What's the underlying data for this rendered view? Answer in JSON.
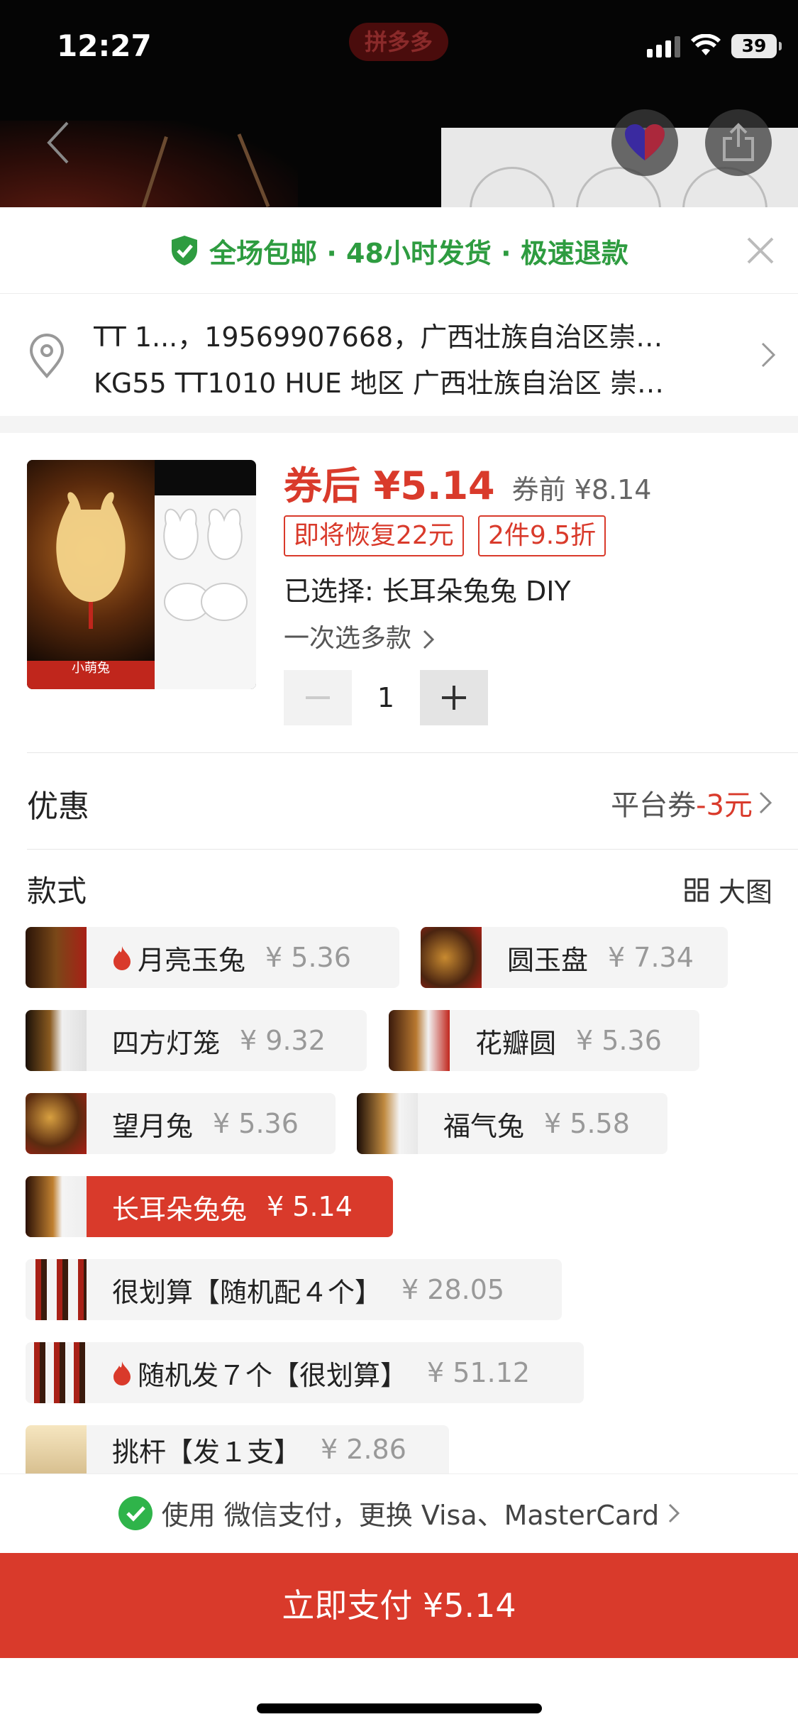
{
  "status_bar": {
    "time": "12:27",
    "battery": "39",
    "app_logo": "拼多多"
  },
  "banner": {
    "text": "全场包邮 · 48小时发货 · 极速退款"
  },
  "address": {
    "line1": "TT 1...，19569907668，广西壮族自治区崇…",
    "line2": "KG55 TT1010 HUE 地区 广西壮族自治区 崇…"
  },
  "product": {
    "price_after": "券后 ¥5.14",
    "price_before": "券前 ¥8.14",
    "badge1": "即将恢复22元",
    "badge2": "2件9.5折",
    "selected": "已选择: 长耳朵兔兔 DIY",
    "more": "一次选多款",
    "quantity": "1",
    "thumb_tag": "小萌兔"
  },
  "promo": {
    "title": "优惠",
    "prefix": "平台券",
    "amount": "-3元"
  },
  "styles": {
    "title": "款式",
    "bigview": "大图",
    "options": [
      {
        "label": "月亮玉兔",
        "price": "¥ 5.36",
        "hot": true
      },
      {
        "label": "圆玉盘",
        "price": "¥ 7.34"
      },
      {
        "label": "四方灯笼",
        "price": "¥ 9.32"
      },
      {
        "label": "花瓣圆",
        "price": "¥ 5.36"
      },
      {
        "label": "望月兔",
        "price": "¥ 5.36"
      },
      {
        "label": "福气兔",
        "price": "¥ 5.58"
      },
      {
        "label": "长耳朵兔兔",
        "price": "¥ 5.14",
        "selected": true
      },
      {
        "label": "很划算【随机配４个】",
        "price": "¥ 28.05"
      },
      {
        "label": "随机发７个【很划算】",
        "price": "¥ 51.12",
        "hot": true
      },
      {
        "label": "挑杆【发１支】",
        "price": "¥ 2.86"
      }
    ]
  },
  "payment": {
    "method": "使用  微信支付，更换 Visa、MasterCard",
    "button": "立即支付 ¥5.14"
  },
  "colors": {
    "accent": "#d93a2b",
    "green": "#2e9c40"
  }
}
